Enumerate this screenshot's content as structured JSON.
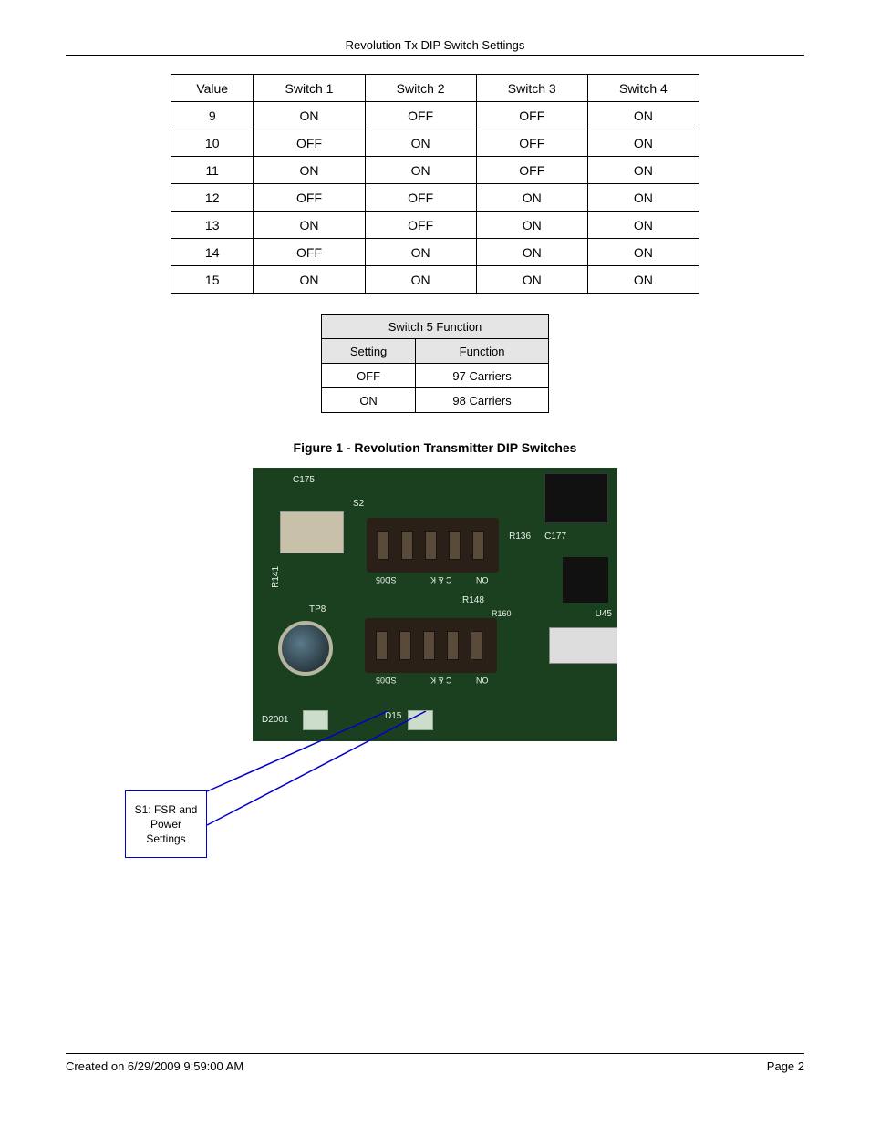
{
  "header": {
    "title": "Revolution Tx DIP Switch Settings"
  },
  "table1": {
    "headers": [
      "Value",
      "Switch 1",
      "Switch 2",
      "Switch 3",
      "Switch 4"
    ],
    "rows": [
      [
        "9",
        "ON",
        "OFF",
        "OFF",
        "ON"
      ],
      [
        "10",
        "OFF",
        "ON",
        "OFF",
        "ON"
      ],
      [
        "11",
        "ON",
        "ON",
        "OFF",
        "ON"
      ],
      [
        "12",
        "OFF",
        "OFF",
        "ON",
        "ON"
      ],
      [
        "13",
        "ON",
        "OFF",
        "ON",
        "ON"
      ],
      [
        "14",
        "OFF",
        "ON",
        "ON",
        "ON"
      ],
      [
        "15",
        "ON",
        "ON",
        "ON",
        "ON"
      ]
    ]
  },
  "table2": {
    "title": "Switch 5 Function",
    "header_left": "Setting",
    "header_right": "Function",
    "rows": [
      [
        "OFF",
        "97 Carriers"
      ],
      [
        "ON",
        "98 Carriers"
      ]
    ]
  },
  "figure_caption": "Figure 1 - Revolution Transmitter DIP Switches",
  "photo_labels": {
    "s2": "S2",
    "r141": "R141",
    "tp8": "TP8",
    "d2001": "D2001",
    "d15": "D15",
    "r148": "R148",
    "r160": "R160",
    "u45": "U45",
    "c175": "C175",
    "r136": "R136",
    "c177": "C177",
    "dip_on": "ON",
    "dip_ck": "C & K",
    "dip_sd05": "SD05"
  },
  "callout_text": "S1: FSR and Power Settings",
  "footer": {
    "left": "Created on 6/29/2009 9:59:00 AM",
    "right": "Page 2"
  }
}
